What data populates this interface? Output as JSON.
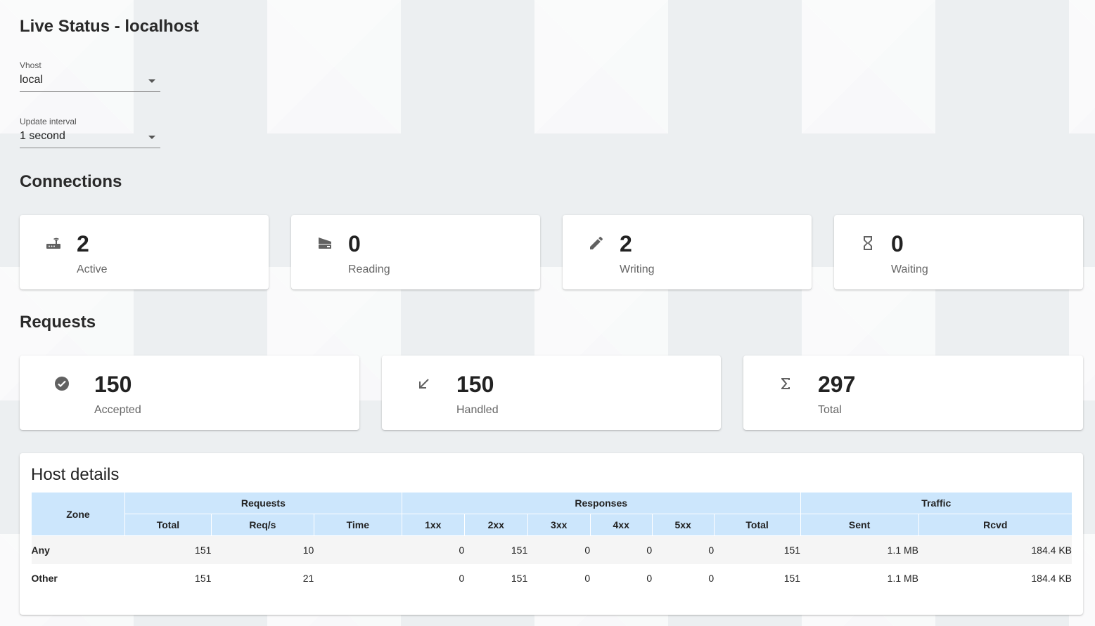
{
  "title": "Live Status - localhost",
  "vhost": {
    "label": "Vhost",
    "value": "local"
  },
  "interval": {
    "label": "Update interval",
    "value": "1 second"
  },
  "connections": {
    "title": "Connections",
    "cards": [
      {
        "icon": "router-icon",
        "value": "2",
        "label": "Active"
      },
      {
        "icon": "inbox-icon",
        "value": "0",
        "label": "Reading"
      },
      {
        "icon": "pencil-icon",
        "value": "2",
        "label": "Writing"
      },
      {
        "icon": "hourglass-icon",
        "value": "0",
        "label": "Waiting"
      }
    ]
  },
  "requests": {
    "title": "Requests",
    "cards": [
      {
        "icon": "check-circle-icon",
        "value": "150",
        "label": "Accepted"
      },
      {
        "icon": "arrow-down-left-icon",
        "value": "150",
        "label": "Handled"
      },
      {
        "icon": "sigma-icon",
        "value": "297",
        "label": "Total"
      }
    ]
  },
  "host_details": {
    "title": "Host details",
    "group_headers": {
      "zone": "Zone",
      "requests": "Requests",
      "responses": "Responses",
      "traffic": "Traffic"
    },
    "sub_headers": [
      "Total",
      "Req/s",
      "Time",
      "1xx",
      "2xx",
      "3xx",
      "4xx",
      "5xx",
      "Total",
      "Sent",
      "Rcvd"
    ],
    "rows": [
      [
        "Any",
        "151",
        "10",
        "",
        "0",
        "151",
        "0",
        "0",
        "0",
        "151",
        "1.1 MB",
        "184.4 KB"
      ],
      [
        "Other",
        "151",
        "21",
        "",
        "0",
        "151",
        "0",
        "0",
        "0",
        "151",
        "1.1 MB",
        "184.4 KB"
      ]
    ]
  }
}
